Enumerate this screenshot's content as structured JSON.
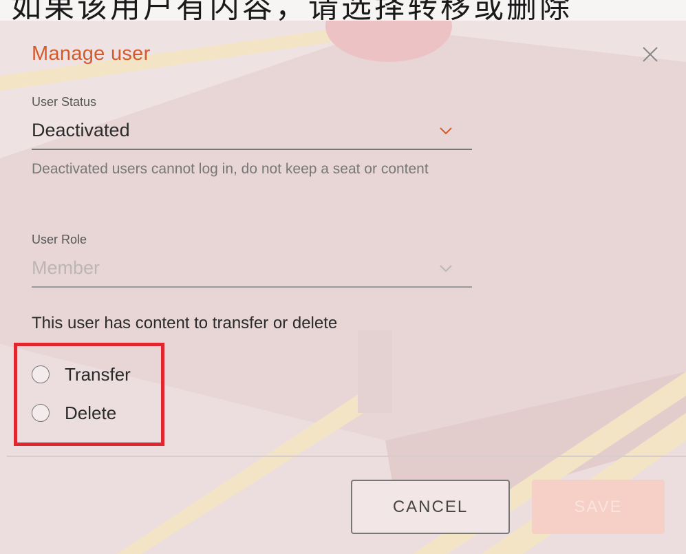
{
  "header": {
    "truncated_caption": "如果该用户有内容，请选择转移或删除"
  },
  "dialog": {
    "title": "Manage user",
    "close_icon": "close-icon"
  },
  "user_status": {
    "label": "User Status",
    "value": "Deactivated",
    "helper": "Deactivated users cannot log in, do not keep a seat or content"
  },
  "user_role": {
    "label": "User Role",
    "value": "Member",
    "disabled": true
  },
  "content_section": {
    "heading": "This user has content to transfer or delete",
    "options": [
      {
        "label": "Transfer",
        "selected": false
      },
      {
        "label": "Delete",
        "selected": false
      }
    ]
  },
  "actions": {
    "cancel_label": "CANCEL",
    "save_label": "SAVE",
    "save_disabled": true
  },
  "colors": {
    "accent": "#d45a2c",
    "highlight": "#e0262f",
    "text": "#2a2a2a",
    "muted": "#777777"
  }
}
